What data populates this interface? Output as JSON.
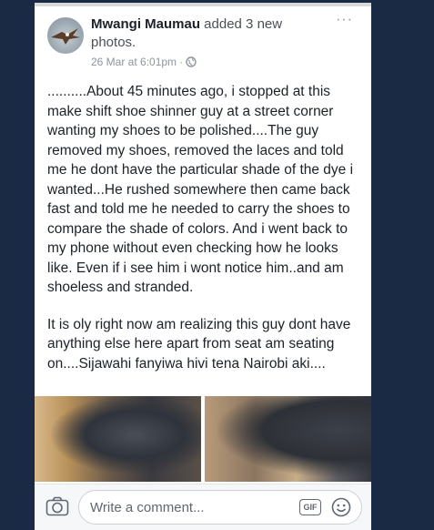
{
  "post": {
    "author": "Mwangi Maumau",
    "action": " added 3 new photos.",
    "timestamp": "26 Mar at 6:01pm",
    "privacy_separator": "·",
    "more_label": "···",
    "paragraphs": [
      "..........About 45 minutes ago, i stopped at this make shift shoe shinner guy at a street corner wanting my shoes to be polished....The guy removed my shoes, removed the laces and told me he dont have the particular shade of the dye i wanted...He rushed somewhere then came back fast and told me he needed to carry the shoes to compare the shade of colors. And i went back to my phone without even checking how he looks like. Even if i see him i wont notice him..and am shoeless and stranded.",
      "It is oly right now am realizing this guy dont have anything else here apart from seat am seating on....Sijawahi fanyiwa hivi tena Nairobi aki...."
    ]
  },
  "photos": [
    {
      "icon": "photo-shoe-dark"
    },
    {
      "icon": "photo-shoe-floor"
    }
  ],
  "comment_bar": {
    "placeholder": "Write a comment...",
    "gif_label": "GIF"
  },
  "colors": {
    "background": "#1b2a44",
    "author": "#1d2129",
    "meta": "#90949c"
  }
}
